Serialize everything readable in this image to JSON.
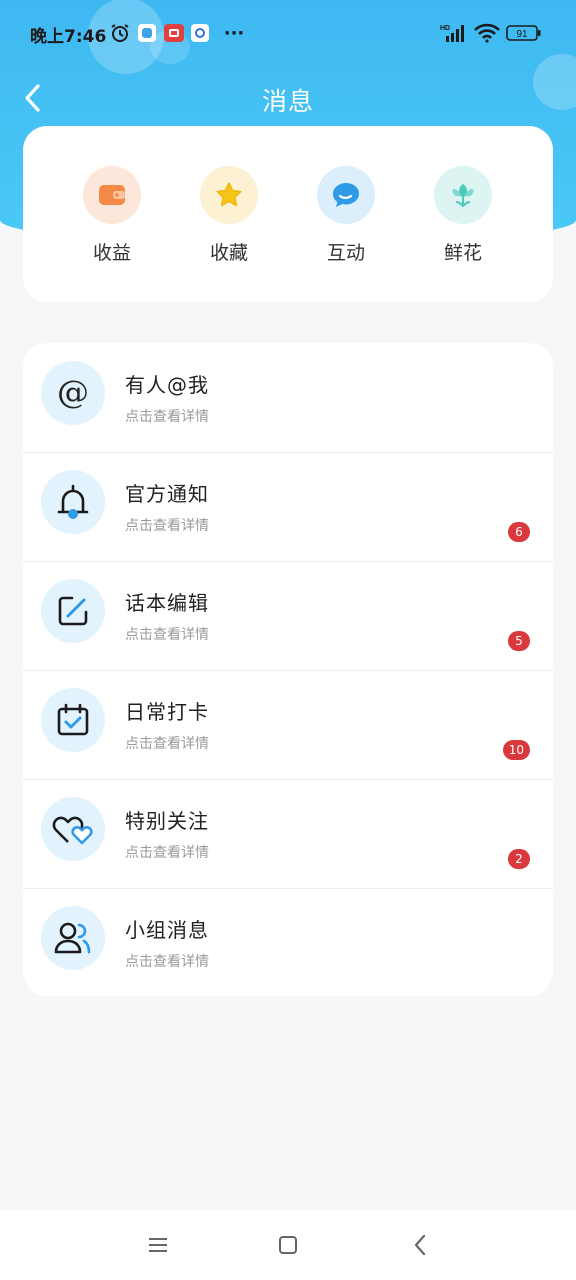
{
  "status_bar": {
    "time": "晚上7:46",
    "network_label": "HD",
    "battery": "91"
  },
  "header": {
    "title": "消息"
  },
  "quick_actions": [
    {
      "label": "收益",
      "icon": "wallet-icon",
      "color": "#f58a48",
      "bg": "#fde7da"
    },
    {
      "label": "收藏",
      "icon": "star-icon",
      "color": "#f5c419",
      "bg": "#fdf1d4"
    },
    {
      "label": "互动",
      "icon": "chat-bubble-icon",
      "color": "#2f9be8",
      "bg": "#dbeefc"
    },
    {
      "label": "鲜花",
      "icon": "flower-icon",
      "color": "#4cc8bd",
      "bg": "#dcf5f2"
    }
  ],
  "messages": [
    {
      "title": "有人@我",
      "subtitle": "点击查看详情",
      "icon": "at-sign-icon",
      "badge": ""
    },
    {
      "title": "官方通知",
      "subtitle": "点击查看详情",
      "icon": "bell-icon",
      "badge": "6"
    },
    {
      "title": "话本编辑",
      "subtitle": "点击查看详情",
      "icon": "edit-icon",
      "badge": "5"
    },
    {
      "title": "日常打卡",
      "subtitle": "点击查看详情",
      "icon": "calendar-check-icon",
      "badge": "10"
    },
    {
      "title": "特别关注",
      "subtitle": "点击查看详情",
      "icon": "hearts-icon",
      "badge": "2"
    },
    {
      "title": "小组消息",
      "subtitle": "点击查看详情",
      "icon": "group-icon",
      "badge": ""
    }
  ],
  "colors": {
    "header_gradient": "#3fb8f2",
    "badge": "#d9383d",
    "accent": "#2f9be8"
  }
}
